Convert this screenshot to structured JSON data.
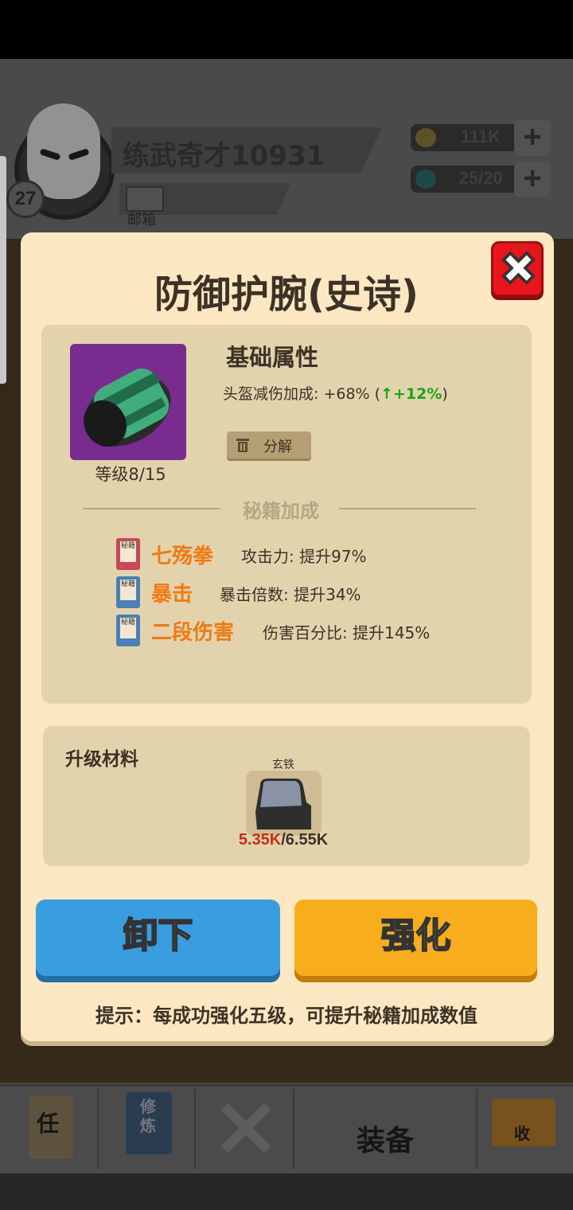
{
  "player": {
    "name": "练武奇才10931",
    "level": "27",
    "mail_label": "邮箱"
  },
  "resources": {
    "gold": "111K",
    "gems": "25/20"
  },
  "modal": {
    "title": "防御护腕(史诗)",
    "close_icon": "close-x-icon",
    "item_level": "等级8/15",
    "base_attr_title": "基础属性",
    "base_attr_text": "头盔减伤加成: +68% (",
    "base_attr_arrow": "↑",
    "base_attr_increase": "+12%",
    "base_attr_close": ")",
    "decompose_label": "分解",
    "bonus_section_title": "秘籍加成",
    "book_tag": "秘籍",
    "skills": [
      {
        "name": "七殇拳",
        "desc": "攻击力: 提升97%",
        "book_color": "#c6485a"
      },
      {
        "name": "暴击",
        "desc": "暴击倍数: 提升34%",
        "book_color": "#4a7fb8"
      },
      {
        "name": "二段伤害",
        "desc": "伤害百分比: 提升145%",
        "book_color": "#4a7fb8"
      }
    ],
    "materials_title": "升级材料",
    "material": {
      "name": "玄铁",
      "have": "5.35K",
      "need": "/6.55K"
    },
    "unequip_label": "卸下",
    "enhance_label": "强化",
    "tip": "提示：每成功强化五级，可提升秘籍加成数值"
  },
  "bottom_nav": {
    "task_label": "任",
    "cultivate_label": "修炼",
    "equipment_label": "装备",
    "collect_label": "收"
  },
  "colors": {
    "modal_bg": "#fbe8c3",
    "panel_bg": "#e3d3ad",
    "unequip_btn": "#3a9de0",
    "enhance_btn": "#f7ad1c",
    "skill_name": "#f07a14",
    "increase_green": "#18a618",
    "close_red": "#e8161c"
  }
}
